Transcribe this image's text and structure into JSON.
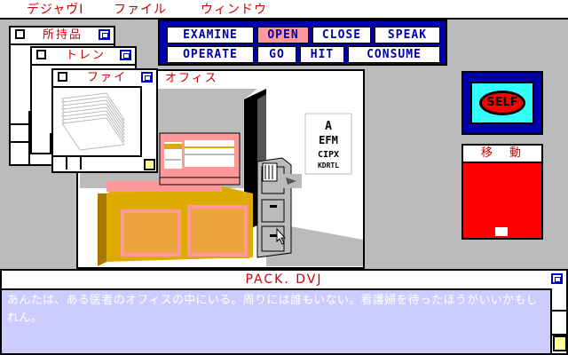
{
  "menu": {
    "items": [
      "デジャヴⅠ",
      "ファイル",
      "ウィンドウ"
    ]
  },
  "windows": {
    "inventory_title": "所持品",
    "train_title": "トレン",
    "file_title": "ファイ",
    "office_title": "オフィス",
    "move_title": "移　動"
  },
  "commands": [
    {
      "label": "EXAMINE",
      "active": false
    },
    {
      "label": "OPEN",
      "active": true
    },
    {
      "label": "CLOSE",
      "active": false
    },
    {
      "label": "SPEAK",
      "active": false
    },
    {
      "label": "OPERATE",
      "active": false
    },
    {
      "label": "GO",
      "active": false
    },
    {
      "label": "HIT",
      "active": false
    },
    {
      "label": "CONSUME",
      "active": false
    }
  ],
  "self_label": "SELF",
  "eye_chart": {
    "line1": "EFM",
    "line2": "CIPX",
    "line3": "KDRTL"
  },
  "text_window": {
    "title": "PACK. DVJ",
    "body": "あんたは、ある医者のオフィスの中にいる。周りには誰もいない。看護婦を待ったほうがいいかもしれん。"
  },
  "colors": {
    "accent_red": "#cc0000",
    "command_blue": "#0000aa",
    "highlight_pink": "#ff9999",
    "self_cyan": "#33ffff",
    "move_red": "#ff0000",
    "text_bg": "#ccccff",
    "desk_yellow": "#ddaa00"
  },
  "icons": [
    "close-box-icon",
    "zoom-box-icon",
    "grow-box-icon",
    "arrow-cursor-icon",
    "card-stack-icon"
  ]
}
